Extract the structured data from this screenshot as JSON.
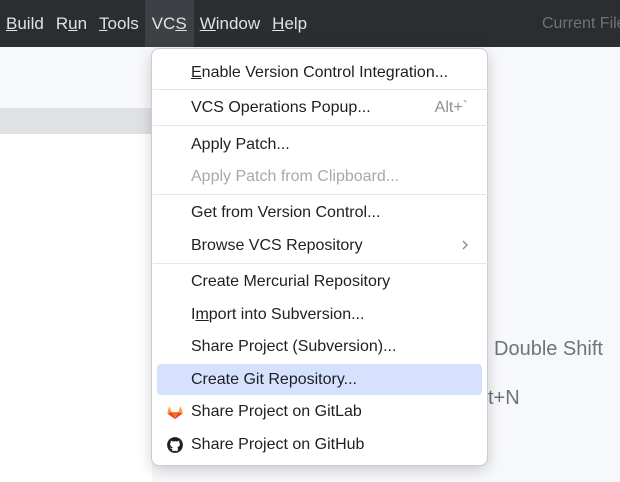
{
  "menubar": {
    "items": [
      {
        "pre": "",
        "key": "B",
        "post": "uild"
      },
      {
        "pre": "R",
        "key": "u",
        "post": "n"
      },
      {
        "pre": "",
        "key": "T",
        "post": "ools"
      },
      {
        "pre": "VC",
        "key": "S",
        "post": ""
      },
      {
        "pre": "",
        "key": "W",
        "post": "indow"
      },
      {
        "pre": "",
        "key": "H",
        "post": "elp"
      }
    ],
    "current_file": "Current File"
  },
  "background": {
    "hint_search": "Double Shift",
    "hint_shortcut": "t+N"
  },
  "vcs_menu": {
    "enable_vci": {
      "pre": "",
      "key": "E",
      "post": "nable Version Control Integration..."
    },
    "operations_popup": {
      "label": "VCS Operations Popup...",
      "shortcut": "Alt+`"
    },
    "apply_patch": "Apply Patch...",
    "apply_patch_clipboard": "Apply Patch from Clipboard...",
    "get_from_vc": "Get from Version Control...",
    "browse_vcs": "Browse VCS Repository",
    "create_mercurial": "Create Mercurial Repository",
    "import_svn": {
      "pre": "I",
      "key": "m",
      "post": "port into Subversion..."
    },
    "share_svn": "Share Project (Subversion)...",
    "create_git": "Create Git Repository...",
    "share_gitlab": "Share Project on GitLab",
    "share_github": "Share Project on GitHub"
  },
  "colors": {
    "menubar_bg": "#2b2d30",
    "highlight": "#d5e1fd",
    "gitlab_orange": "#e2432a"
  }
}
